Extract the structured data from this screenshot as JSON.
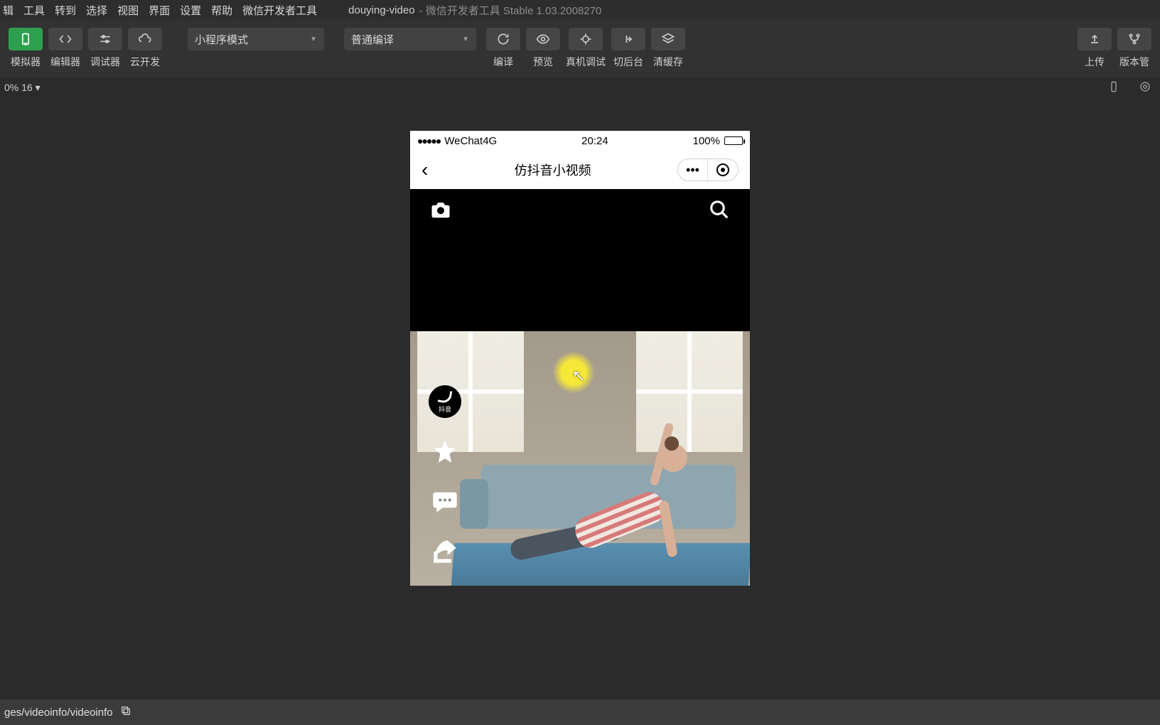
{
  "menu": {
    "items": [
      "辑",
      "工具",
      "转到",
      "选择",
      "视图",
      "界面",
      "设置",
      "帮助",
      "微信开发者工具"
    ],
    "project": "douying-video",
    "app_title": "- 微信开发者工具 Stable 1.03.2008270"
  },
  "toolbar": {
    "simulator": "模拟器",
    "editor": "编辑器",
    "debugger": "调试器",
    "cloud": "云开发",
    "mode_select": "小程序模式",
    "compile_select": "普通编译",
    "compile": "编译",
    "preview": "预览",
    "remote_debug": "真机调试",
    "background": "切后台",
    "clear_cache": "清缓存",
    "upload": "上传",
    "version": "版本管"
  },
  "statusbar": {
    "zoom": "0% 16 ▾"
  },
  "phone": {
    "carrier": "WeChat4G",
    "time": "20:24",
    "battery": "100%",
    "page_title": "仿抖音小视频",
    "douyin_label": "抖音"
  },
  "path_bar": {
    "path": "ges/videoinfo/videoinfo"
  }
}
